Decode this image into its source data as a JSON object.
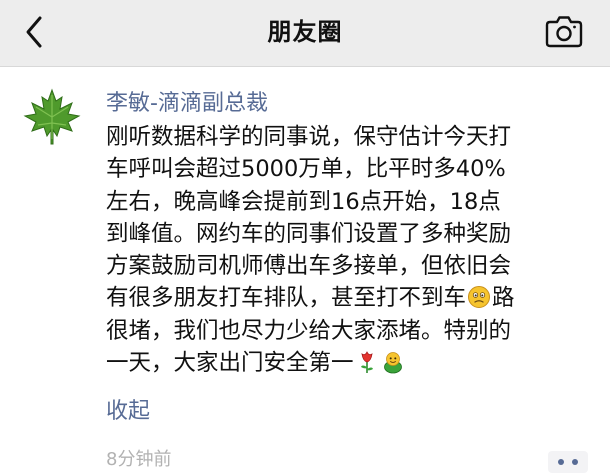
{
  "nav": {
    "title": "朋友圈",
    "back_icon": "chevron-left-icon",
    "camera_icon": "camera-icon"
  },
  "post": {
    "avatar_icon": "maple-leaf-avatar",
    "author": "李敏-滴滴副总裁",
    "lines": [
      "刚听数据科学的同事说，保守估计今天打",
      "车呼叫会超过5000万单，比平时多40%",
      "左右，晚高峰会提前到16点开始，18点",
      "到峰值。网约车的同事们设置了多种奖励",
      "方案鼓励司机师傅出车多接单，但依旧会",
      "有很多朋友打车排队，甚至打不到车",
      "路",
      "很堵，我们也尽力少给大家添堵。特别的",
      "一天，大家出门安全第一"
    ],
    "emojis": [
      "worried-face-emoji",
      "rose-emoji",
      "frog-emoji"
    ],
    "collapse_label": "收起",
    "timestamp": "8分钟前",
    "more_icon": "more-dots-icon"
  },
  "colors": {
    "nav_bg": "#ededed",
    "link": "#576b95",
    "text": "#111111",
    "timestamp": "#b2b2b2"
  }
}
